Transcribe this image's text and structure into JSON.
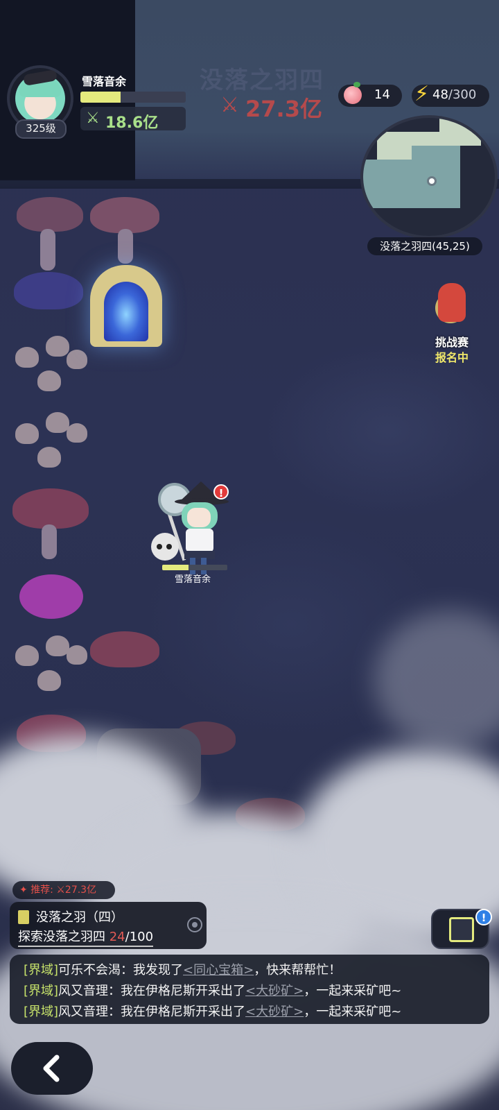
{
  "player": {
    "name": "雪落音余",
    "level": "325级",
    "power": "18.6亿",
    "xp_fraction": 0.38,
    "hp_fraction": 0.4
  },
  "area": {
    "title": "没落之羽四",
    "recommended_power": "27.3亿"
  },
  "resources": {
    "peach_count": "14",
    "energy_current": "48",
    "energy_max": "/300"
  },
  "minimap": {
    "label": "没落之羽四(45,25)"
  },
  "event": {
    "title": "挑战赛",
    "status": "报名中"
  },
  "quest": {
    "recommend_label": "推荐:",
    "recommend_power": "27.3亿",
    "title": "没落之羽（四）",
    "task_prefix": "探索没落之羽四",
    "progress_current": "24",
    "progress_total": "/100"
  },
  "box_badge": "!",
  "chat": {
    "lines": [
      {
        "channel": "[界域]",
        "text_before": "可乐不会渴：我发现了",
        "item": "<同心宝箱>",
        "text_after": "，快来帮帮忙！"
      },
      {
        "channel": "[界域]",
        "text_before": "风又音理：我在伊格尼斯开采出了",
        "item": "<大砂矿>",
        "text_after": "，一起来采矿吧~"
      },
      {
        "channel": "[界域]",
        "text_before": "风又音理：我在伊格尼斯开采出了",
        "item": "<大砂矿>",
        "text_after": "，一起来采矿吧~"
      }
    ]
  },
  "colors": {
    "accent_yellow": "#e4ea7e",
    "power_green": "#a9e08a",
    "danger_red": "#b54a4c",
    "chat_channel": "#c7e36b"
  },
  "icons": {
    "power": "crossed-swords-icon",
    "peach": "peach-icon",
    "energy": "lightning-icon",
    "quest": "scroll-icon",
    "locate": "target-icon",
    "box": "cube-icon",
    "back": "chevron-left-icon"
  }
}
